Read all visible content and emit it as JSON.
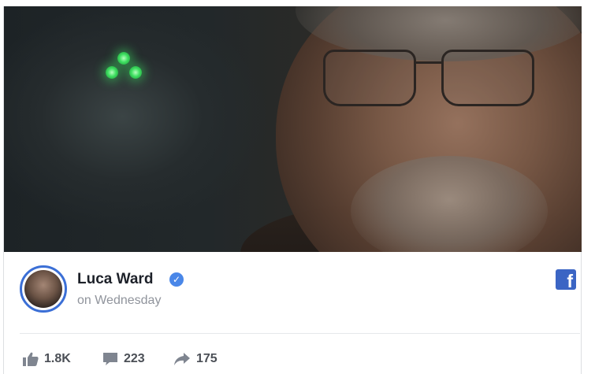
{
  "post": {
    "author": "Luca Ward",
    "verified": true,
    "timestamp": "on Wednesday",
    "network_icon": "facebook-icon"
  },
  "stats": {
    "likes": "1.8K",
    "comments": "223",
    "shares": "175"
  },
  "icons": {
    "likes": "thumbs-up-icon",
    "comments": "comment-bubble-icon",
    "shares": "share-arrow-icon",
    "verified": "verified-check-icon"
  },
  "colors": {
    "facebook_blue": "#3b65c4",
    "verified_blue": "#4a87e8",
    "avatar_ring": "#3b6fd6",
    "meta_gray": "#90949c",
    "stat_gray": "#4b4f56"
  }
}
